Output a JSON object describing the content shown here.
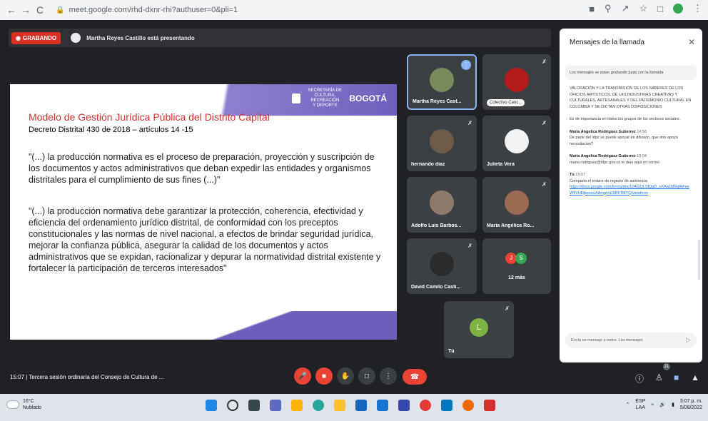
{
  "browser": {
    "url": "meet.google.com/rhd-dxnr-rhi?authuser=0&pli=1",
    "back": "←",
    "forward": "→",
    "reload": "C"
  },
  "meet": {
    "recording_label": "GRABANDO",
    "presenting_text": "Martha Reyes Castillo está presentando",
    "meeting_time": "15:07",
    "meeting_name": "Tercera sesión ordinaria del Consejo de Cultura de ...",
    "participants_count": "21"
  },
  "slide": {
    "title": "Modelo de Gestión Jurídica Pública del Distrito Capital",
    "subtitle": "Decreto Distrital 430 de 2018 – artículos 14 -15",
    "paragraph1": "\"(...) la producción normativa es el proceso de preparación, proyección y suscripción de los documentos y actos administrativos que deban expedir las entidades y organismos distritales para el cumplimiento de sus fines (...)\"",
    "paragraph2": "\"(...) la producción normativa debe garantizar la protección, coherencia, efectividad y eficiencia del ordenamiento jurídico distrital, de conformidad con los preceptos constitucionales y las normas de nivel nacional, a efectos de brindar seguridad jurídica, mejorar la confianza pública, asegurar la calidad de los documentos y actos administrativos que se expidan, racionalizar y depurar la normatividad distrital existente y fortalecer la participación de terceros interesados\"",
    "logo_text": "SECRETARÍA DE CULTURA, RECREACIÓN Y DEPORTE",
    "bogota": "BOGOTÁ"
  },
  "participants": [
    {
      "name": "Martha Reyes Cast...",
      "color": "#7a8a5c",
      "speaking": true
    },
    {
      "name": "Colectivo Canc...",
      "color": "#b71c1c",
      "speaking": false
    },
    {
      "name": "hernando diaz",
      "color": "#6d5a48",
      "speaking": false
    },
    {
      "name": "Julieta Vera",
      "color": "#f2f2f2",
      "speaking": false
    },
    {
      "name": "Adolfo Luis Barbos...",
      "color": "#8c7b6b",
      "speaking": false
    },
    {
      "name": "María Angélica Ro...",
      "color": "#9a6a52",
      "speaking": false
    },
    {
      "name": "David Camilo Casti...",
      "color": "#2b2b2b",
      "speaking": false
    },
    {
      "name": "12 más",
      "color": "",
      "speaking": false
    },
    {
      "name": "Tú",
      "color": "#7cb342",
      "speaking": false
    }
  ],
  "more_initials": [
    "J",
    "S"
  ],
  "you_initial": "L",
  "chat": {
    "title": "Mensajes de la llamada",
    "note": "Los mensajes se están grabando junto con la llamada",
    "prev_text": "VALORACIÓN Y LA TRANSMISIÓN DE LOS SABERES DE LOS OFICIOS ARTÍSTICOS, DE LAS INDUSTRIAS CREATIVAS Y CULTURALES, ARTESANALES Y DEL PATRIMONIO CULTURAL EN COLOMBIA Y SE DICTAN OTRAS DISPOSICIONES",
    "prev_text2": "Es de importancia en todos los grupos de los sectores sociales.",
    "messages": [
      {
        "author": "Maria Angelica Rodriguez Gutierrez",
        "time": "14:58",
        "text": "De parte del idpc se puede apoyar en difusión, que otro apoyo necesitarían?"
      },
      {
        "author": "Maria Angelica Rodriguez Gutierrez",
        "time": "15:04",
        "text": "maria.rodriguez@idpc.gov.co te dejo aquí mi correo"
      },
      {
        "author": "Tú",
        "time": "15:07",
        "text": "Comparto el enlace de registro de asistencia",
        "link": "https://docs.google.com/forms/d/e/1FAIpQLSfQgD_uXAaO8RqWFeeW9VHDjbxeeuAAmgvvU9RhTMYQ/viewform"
      }
    ],
    "input_placeholder": "Envía un mensaje a todos. Los mensajes"
  },
  "taskbar": {
    "temp": "16°C",
    "weather": "Nublado",
    "lang1": "ESP",
    "lang2": "LAA",
    "time": "3:07 p. m.",
    "date": "5/08/2022"
  },
  "colors": {
    "accent": "#8ab4f8",
    "record": "#d93025",
    "end_call": "#ea4335"
  }
}
